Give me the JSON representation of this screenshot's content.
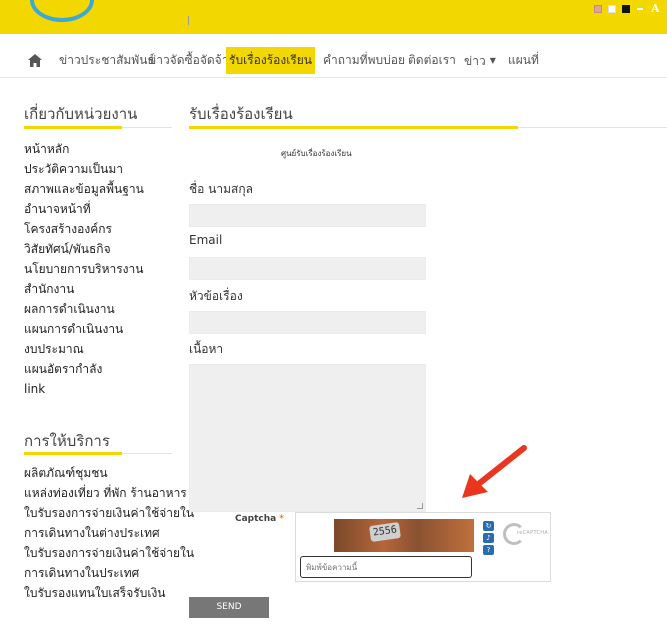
{
  "header": {
    "accessibility": {
      "text_size_label": "A"
    }
  },
  "nav": {
    "items": [
      {
        "label": "ข่าวประชาสัมพันธ์"
      },
      {
        "label": "ข่าวจัดซื้อจัดจ้าง"
      },
      {
        "label": "รับเรื่องร้องเรียน",
        "active": true
      },
      {
        "label": "คำถามที่พบบ่อย"
      },
      {
        "label": "ติดต่อเรา"
      },
      {
        "label": "ข่าว",
        "dropdown": true
      },
      {
        "label": "แผนที่"
      }
    ],
    "accent_color": "#f2d800"
  },
  "sidebar": {
    "about": {
      "heading": "เกี่ยวกับหน่วยงาน",
      "items": [
        "หน้าหลัก",
        "ประวัติความเป็นมา",
        "สภาพและข้อมูลพื้นฐาน",
        "อำนาจหน้าที่",
        "โครงสร้างองค์กร",
        "วิสัยทัศน์/พันธกิจ",
        "นโยบายการบริหารงาน",
        "สำนักงาน",
        "ผลการดำเนินงาน",
        "แผนการดำเนินงาน",
        "งบประมาณ",
        "แผนอัตรากำลัง",
        "link"
      ]
    },
    "services": {
      "heading": "การให้บริการ",
      "items": [
        "ผลิตภัณฑ์ชุมชน",
        "แหล่งท่องเที่ยว ที่พัก ร้านอาหาร",
        "ใบรับรองการจ่ายเงินค่าใช้จ่ายใน",
        "การเดินทางในต่างประเทศ",
        "ใบรับรองการจ่ายเงินค่าใช้จ่ายใน",
        "การเดินทางในประเทศ",
        "ใบรับรองแทนใบเสร็จรับเงิน"
      ]
    }
  },
  "main": {
    "title": "รับเรื่องร้องเรียน",
    "form_caption": "ศูนย์รับเรื่องร้องเรียน",
    "fields": {
      "name_label": "ชื่อ นามสกุล",
      "email_label": "Email",
      "subject_label": "หัวข้อเรื่อง",
      "content_label": "เนื้อหา"
    },
    "captcha": {
      "label": "Captcha",
      "required_mark": "*",
      "image_text": "2556",
      "input_placeholder": "พิมพ์ข้อความนี้",
      "logo_text": "reCAPTCHA"
    },
    "send_label": "SEND"
  },
  "annotation": {
    "arrow_color": "#e8361f"
  }
}
